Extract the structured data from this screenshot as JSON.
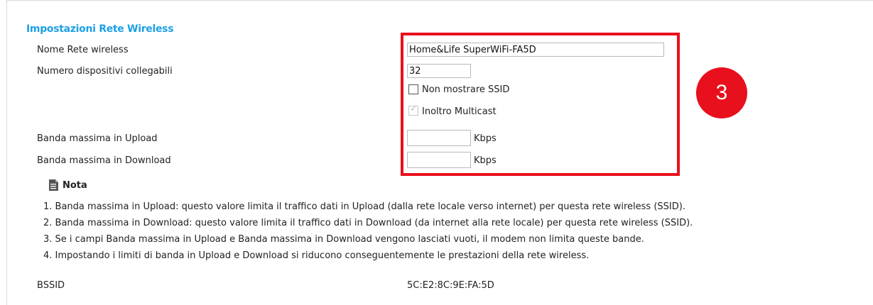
{
  "section_title": "Impostazioni Rete Wireless",
  "fields": {
    "ssid_label": "Nome Rete wireless",
    "ssid_value": "Home&Life SuperWiFi-FA5D",
    "max_devices_label": "Numero dispositivi collegabili",
    "max_devices_value": "32",
    "hide_ssid_label": "Non mostrare SSID",
    "hide_ssid_checked": false,
    "multicast_label": "Inoltro Multicast",
    "multicast_checked": true,
    "upload_label": "Banda massima in Upload",
    "upload_value": "",
    "upload_unit": "Kbps",
    "download_label": "Banda massima in Download",
    "download_value": "",
    "download_unit": "Kbps"
  },
  "step_badge": "3",
  "note": {
    "title": "Nota",
    "icon": "document-icon",
    "lines": [
      "1. Banda massima in Upload: questo valore limita il traffico dati in Upload (dalla rete locale verso internet) per questa rete wireless (SSID).",
      "2. Banda massima in Download: questo valore limita il traffico dati in Download (da internet alla rete locale) per questa rete wireless (SSID).",
      "3. Se i campi Banda massima in Upload e Banda massima in Download vengono lasciati vuoti, il modem non limita queste bande.",
      "4. Impostando i limiti di banda in Upload e Download si riducono conseguentemente le prestazioni della rete wireless."
    ]
  },
  "bssid": {
    "label": "BSSID",
    "value": "5C:E2:8C:9E:FA:5D"
  },
  "colors": {
    "title": "#1ea0e6",
    "highlight": "#e8101c"
  }
}
